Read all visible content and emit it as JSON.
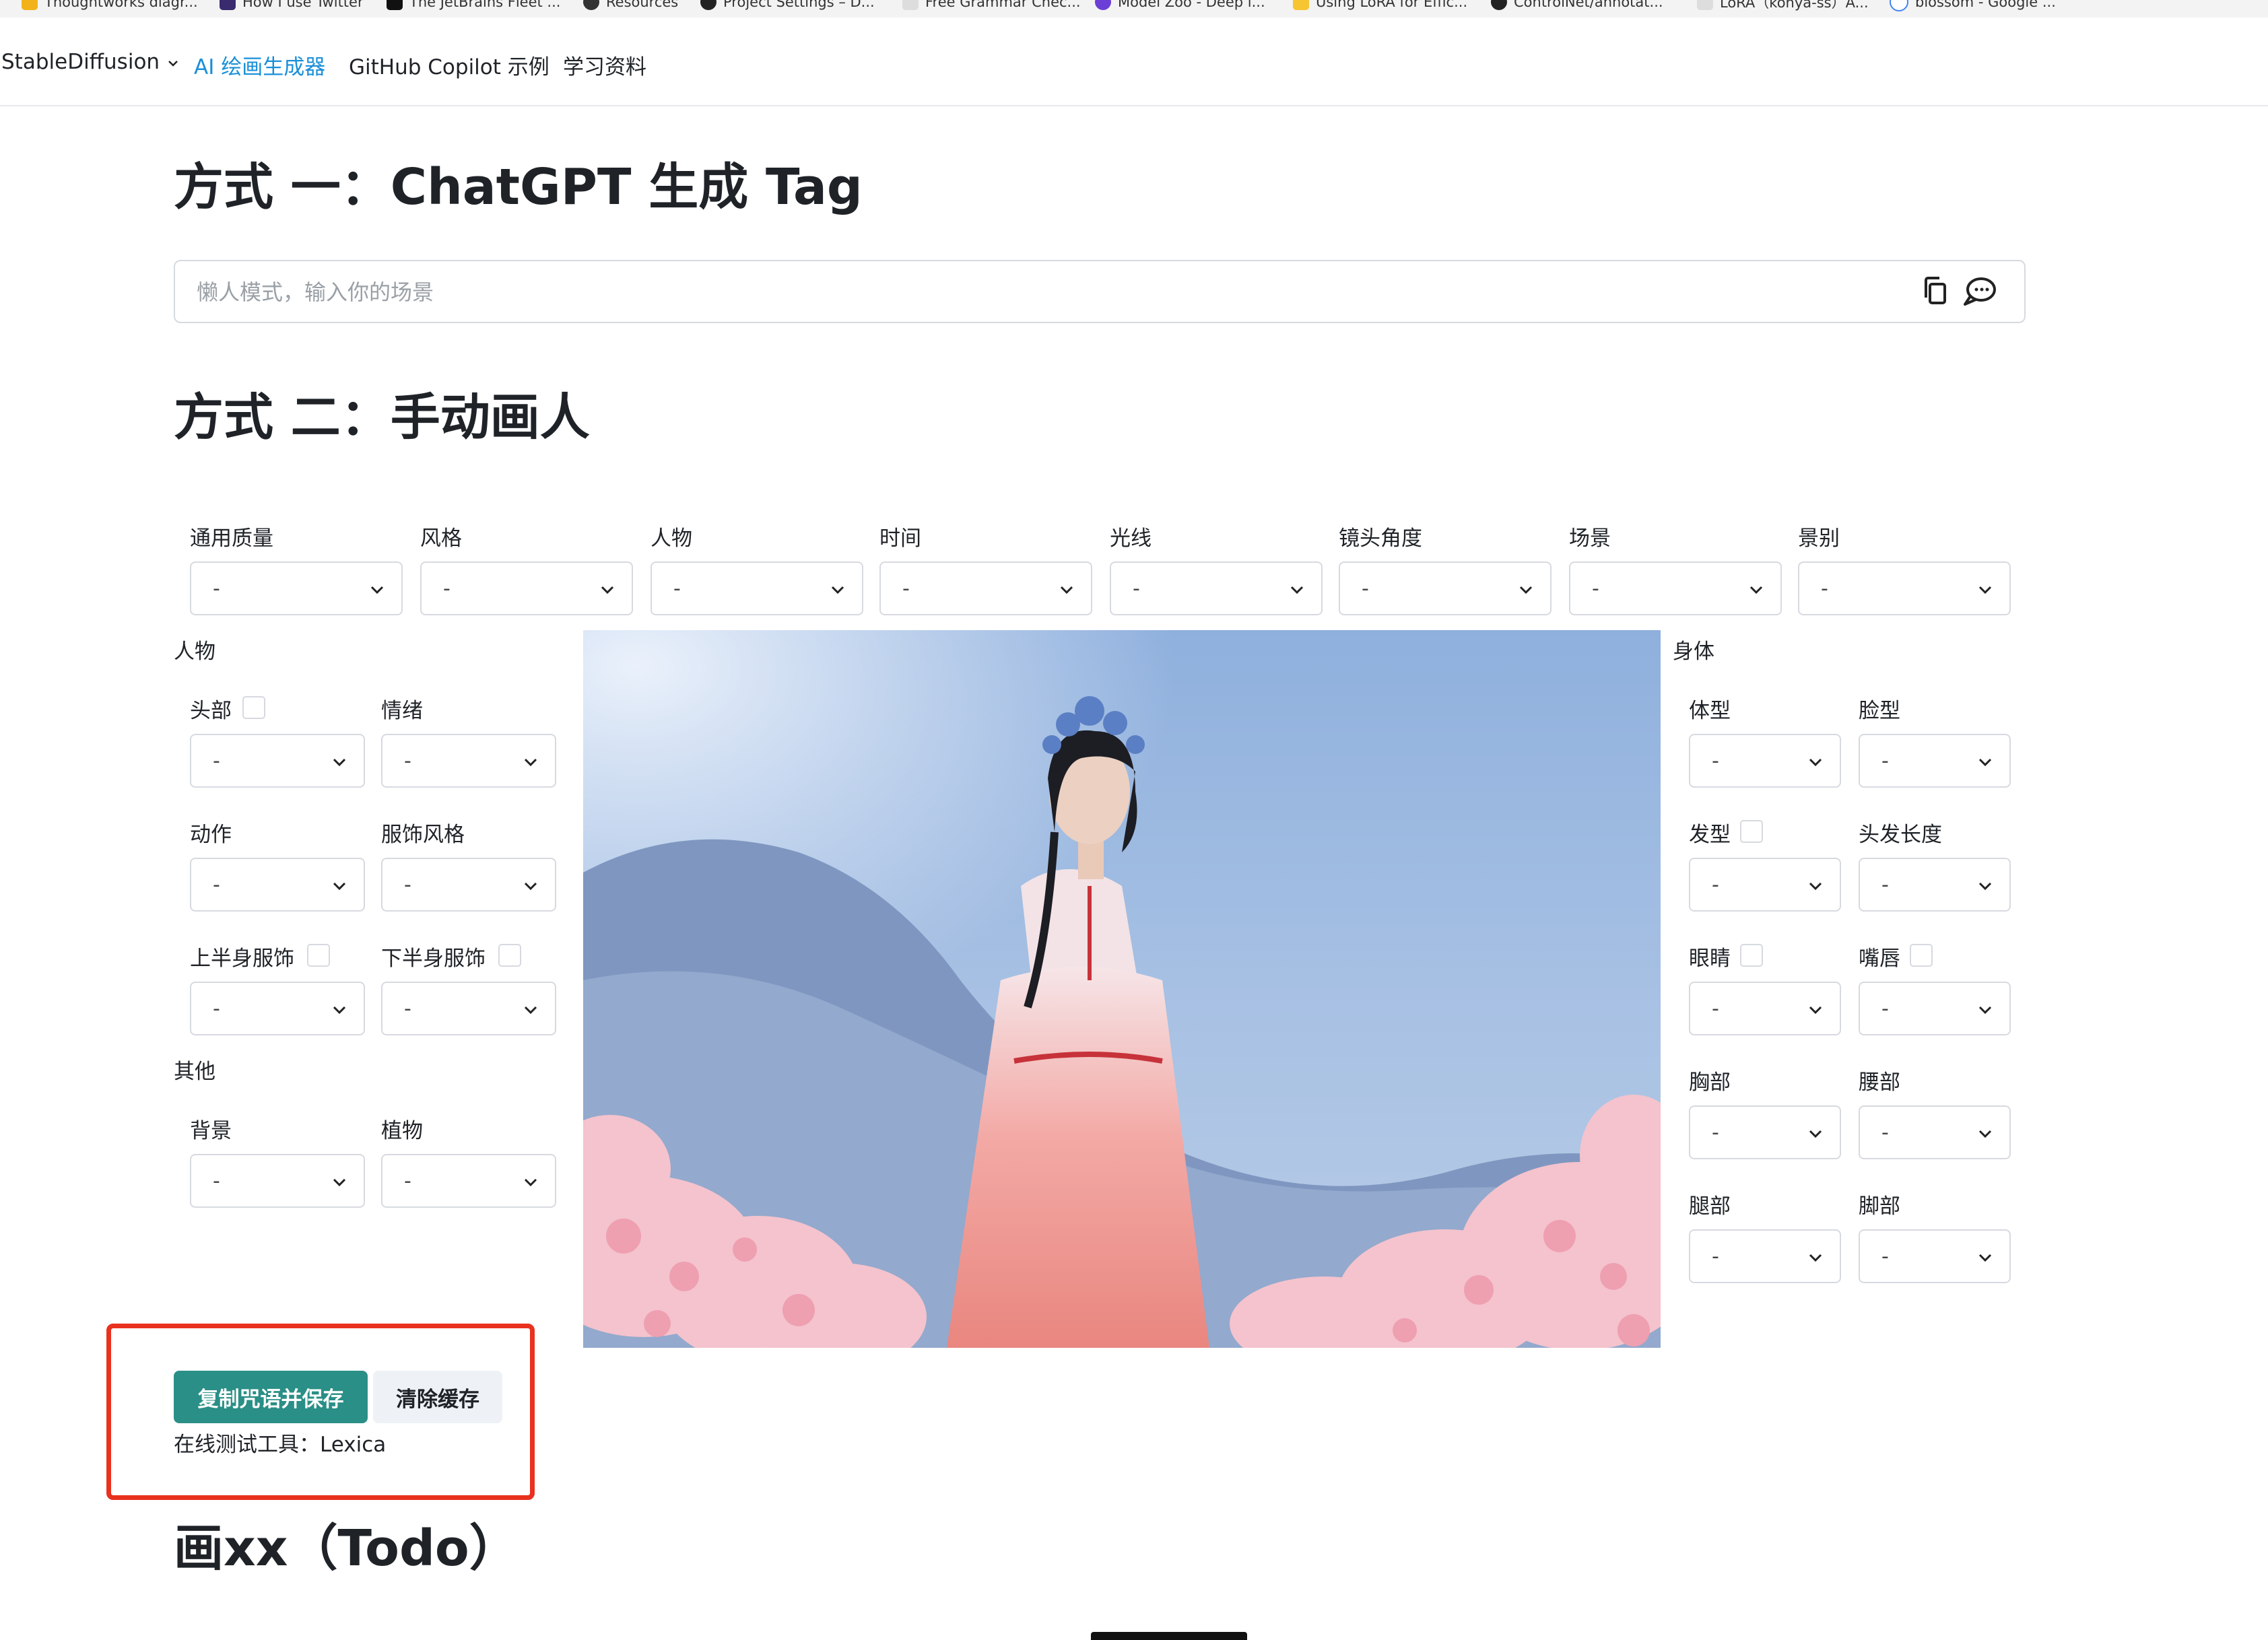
{
  "bookmarks": [
    "Thoughtworks diagr...",
    "How I use Twitter",
    "The JetBrains Fleet ...",
    "Resources",
    "Project Settings – D...",
    "Free Grammar Chec...",
    "Model Zoo - Deep l...",
    "Using LoRA for Effic...",
    "ControlNet/annotat...",
    "LoRA（kohya-ss）A...",
    "blossom - Google ..."
  ],
  "nav": {
    "brand": "StableDiffusion",
    "items": [
      "AI 绘画生成器",
      "GitHub Copilot 示例",
      "学习资料"
    ]
  },
  "method1": {
    "title": "方式 一：ChatGPT 生成 Tag",
    "placeholder": "懒人模式，输入你的场景"
  },
  "method2": {
    "title": "方式 二：手动画人"
  },
  "top_selects": [
    {
      "label": "通用质量",
      "value": "-"
    },
    {
      "label": "风格",
      "value": "-"
    },
    {
      "label": "人物",
      "value": "-"
    },
    {
      "label": "时间",
      "value": "-"
    },
    {
      "label": "光线",
      "value": "-"
    },
    {
      "label": "镜头角度",
      "value": "-"
    },
    {
      "label": "场景",
      "value": "-"
    },
    {
      "label": "景别",
      "value": "-"
    }
  ],
  "person": {
    "title": "人物",
    "fields": [
      {
        "label": "头部",
        "value": "-"
      },
      {
        "label": "情绪",
        "value": "-"
      },
      {
        "label": "动作",
        "value": "-"
      },
      {
        "label": "服饰风格",
        "value": "-"
      },
      {
        "label": "上半身服饰",
        "value": "-"
      },
      {
        "label": "下半身服饰",
        "value": "-"
      }
    ]
  },
  "other": {
    "title": "其他",
    "fields": [
      {
        "label": "背景",
        "value": "-"
      },
      {
        "label": "植物",
        "value": "-"
      }
    ]
  },
  "body": {
    "title": "身体",
    "fields": [
      {
        "label": "体型",
        "value": "-"
      },
      {
        "label": "脸型",
        "value": "-"
      },
      {
        "label": "发型",
        "value": "-"
      },
      {
        "label": "头发长度",
        "value": "-"
      },
      {
        "label": "眼睛",
        "value": "-"
      },
      {
        "label": "嘴唇",
        "value": "-"
      },
      {
        "label": "胸部",
        "value": "-"
      },
      {
        "label": "腰部",
        "value": "-"
      },
      {
        "label": "腿部",
        "value": "-"
      },
      {
        "label": "脚部",
        "value": "-"
      }
    ]
  },
  "actions": {
    "save": "复制咒语并保存",
    "clear": "清除缓存",
    "tool_prefix": "在线测试工具：",
    "tool_link": "Lexica"
  },
  "todo_title": "画xx（Todo）",
  "colors": {
    "accent": "#1a8fd8",
    "save_button": "#2a8f86",
    "highlight_box": "#e8321f"
  }
}
